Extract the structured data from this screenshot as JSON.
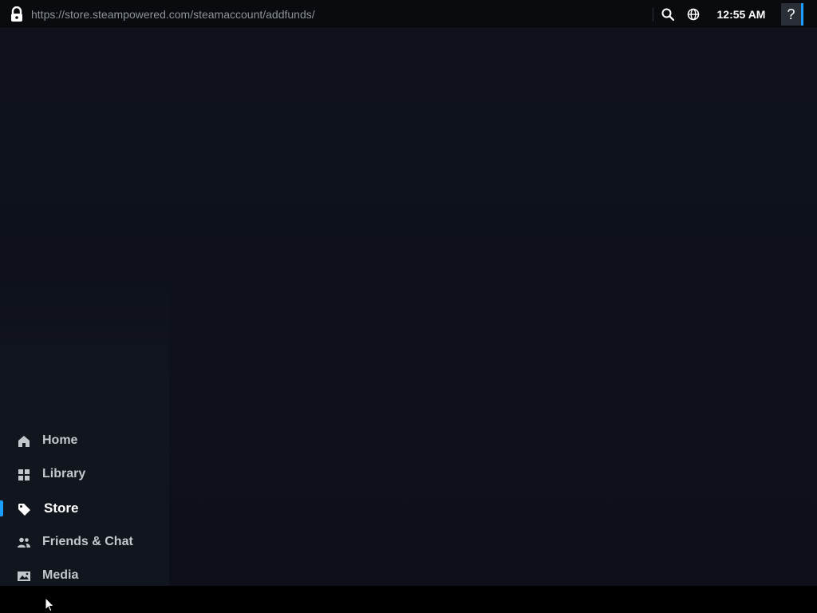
{
  "browser": {
    "url": "https://store.steampowered.com/steamaccount/addfunds/",
    "clock": "12:55 AM",
    "help_label": "?",
    "icons": [
      "lock-icon",
      "search-icon",
      "globe-icon"
    ]
  },
  "menu": {
    "items": [
      {
        "label": "Home",
        "icon": "home-icon"
      },
      {
        "label": "Library",
        "icon": "grid-icon"
      },
      {
        "label": "Store",
        "icon": "tag-icon",
        "active": true
      },
      {
        "label": "Friends & Chat",
        "icon": "friends-icon"
      },
      {
        "label": "Media",
        "icon": "image-icon"
      }
    ]
  },
  "colors": {
    "accent": "#1a9fff",
    "background": "#0e111a",
    "topbar": "#0a0b0f"
  }
}
